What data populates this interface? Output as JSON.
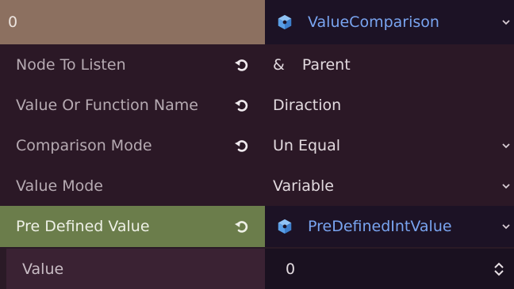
{
  "header": {
    "left_value": "0",
    "resource_name": "ValueComparison"
  },
  "properties": [
    {
      "label": "Node To Listen",
      "value_prefix": "&",
      "value": "Parent"
    },
    {
      "label": "Value Or Function Name",
      "value": "Diraction"
    },
    {
      "label": "Comparison Mode",
      "value": "Un Equal"
    },
    {
      "label": "Value Mode",
      "value": "Variable"
    },
    {
      "label": "Pre Defined Value",
      "value": "PreDefinedIntValue"
    }
  ],
  "sub_property": {
    "label": "Value",
    "value": "0"
  },
  "colors": {
    "header_label_bg": "#8c7060",
    "highlight_row_bg": "#6b7d4b",
    "resource_text": "#79a4f0",
    "panel_bg": "#2b1826"
  },
  "icons": {
    "resource": "cube-icon",
    "revert": "revert-icon",
    "dropdown": "chevron-down-icon",
    "spinner": "spinner-arrows-icon"
  }
}
